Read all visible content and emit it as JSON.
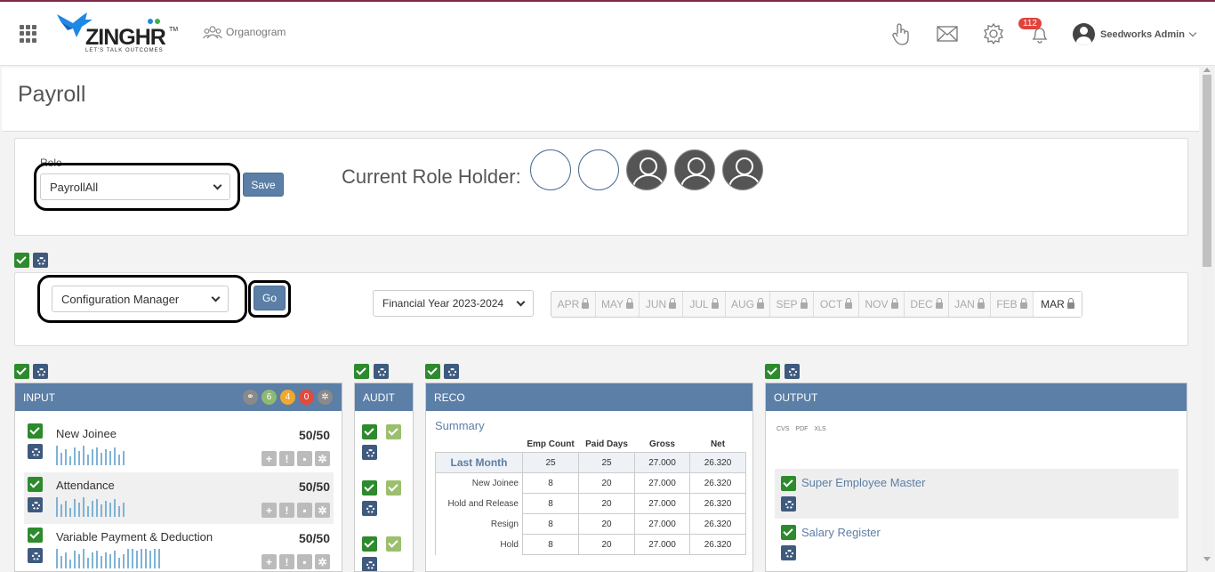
{
  "header": {
    "brand_main": "ZING",
    "brand_hr": "HR",
    "brand_tm": "TM",
    "brand_tagline": "LET'S TALK OUTCOMES",
    "organogram_label": "Organogram",
    "notification_count": "112",
    "user_name": "Seedworks Admin",
    "brand_color": "#1e88e5"
  },
  "page": {
    "title": "Payroll"
  },
  "role": {
    "label": "Role",
    "selected": "PayrollAll",
    "save_label": "Save",
    "current_role_holder_label": "Current Role Holder:"
  },
  "manager": {
    "selected": "Configuration Manager",
    "go_label": "Go",
    "financial_year": "Financial Year 2023-2024",
    "months": [
      "APR",
      "MAY",
      "JUN",
      "JUL",
      "AUG",
      "SEP",
      "OCT",
      "NOV",
      "DEC",
      "JAN",
      "FEB",
      "MAR"
    ]
  },
  "input_panel": {
    "title": "INPUT",
    "status_counts": [
      "6",
      "4",
      "0"
    ],
    "status_colors": [
      "#8fb872",
      "#f0a830",
      "#e04a3f"
    ],
    "rows": [
      {
        "label": "New Joinee",
        "count": "50/50"
      },
      {
        "label": "Attendance",
        "count": "50/50"
      },
      {
        "label": "Variable Payment & Deduction",
        "count": "50/50"
      }
    ]
  },
  "audit_panel": {
    "title": "AUDIT"
  },
  "reco_panel": {
    "title": "RECO",
    "summary_label": "Summary",
    "columns": [
      "Emp Count",
      "Paid Days",
      "Gross",
      "Net"
    ],
    "rows": [
      {
        "label": "Last Month",
        "values": [
          "25",
          "25",
          "27.000",
          "26.320"
        ]
      },
      {
        "label": "New Joinee",
        "values": [
          "8",
          "20",
          "27.000",
          "26.320"
        ]
      },
      {
        "label": "Hold and Release",
        "values": [
          "8",
          "20",
          "27.000",
          "26.320"
        ]
      },
      {
        "label": "Resign",
        "values": [
          "8",
          "20",
          "27.000",
          "26.320"
        ]
      },
      {
        "label": "Hold",
        "values": [
          "8",
          "20",
          "27.000",
          "26.320"
        ]
      }
    ]
  },
  "output_panel": {
    "title": "OUTPUT",
    "formats": [
      "CVS",
      "PDF",
      "XLS"
    ],
    "items": [
      "Super Employee Master",
      "Salary Register"
    ]
  }
}
